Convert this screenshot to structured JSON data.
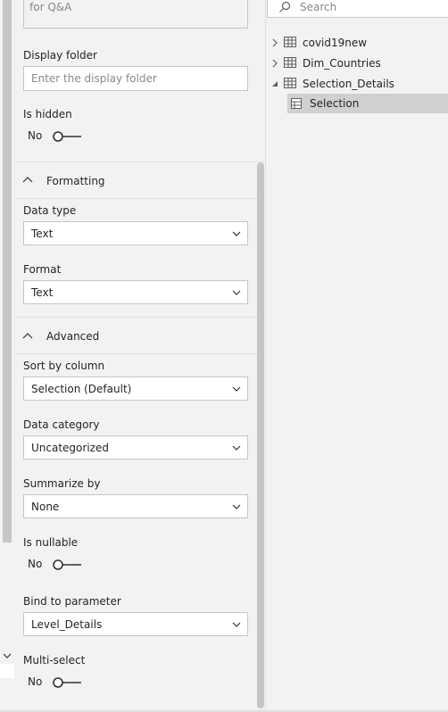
{
  "qa_field": {
    "value": "for Q&A"
  },
  "display_folder": {
    "label": "Display folder",
    "placeholder": "Enter the display folder"
  },
  "is_hidden": {
    "label": "Is hidden",
    "state": "No"
  },
  "formatting": {
    "title": "Formatting",
    "data_type": {
      "label": "Data type",
      "value": "Text"
    },
    "format": {
      "label": "Format",
      "value": "Text"
    }
  },
  "advanced": {
    "title": "Advanced",
    "sort_by_column": {
      "label": "Sort by column",
      "value": "Selection (Default)"
    },
    "data_category": {
      "label": "Data category",
      "value": "Uncategorized"
    },
    "summarize_by": {
      "label": "Summarize by",
      "value": "None"
    },
    "is_nullable": {
      "label": "Is nullable",
      "state": "No"
    },
    "bind_to_parameter": {
      "label": "Bind to parameter",
      "value": "Level_Details"
    },
    "multi_select": {
      "label": "Multi-select",
      "state": "No"
    }
  },
  "search": {
    "placeholder": "Search"
  },
  "fields_tree": {
    "tables": [
      {
        "name": "covid19new",
        "expanded": false
      },
      {
        "name": "Dim_Countries",
        "expanded": false
      },
      {
        "name": "Selection_Details",
        "expanded": true
      }
    ],
    "selected_column": "Selection"
  },
  "colors": {
    "panel_bg": "#f3f2f1",
    "field_border": "#c8c6c4",
    "selected_bg": "#d2d0ce",
    "scrollbar": "#c8c6c4"
  }
}
